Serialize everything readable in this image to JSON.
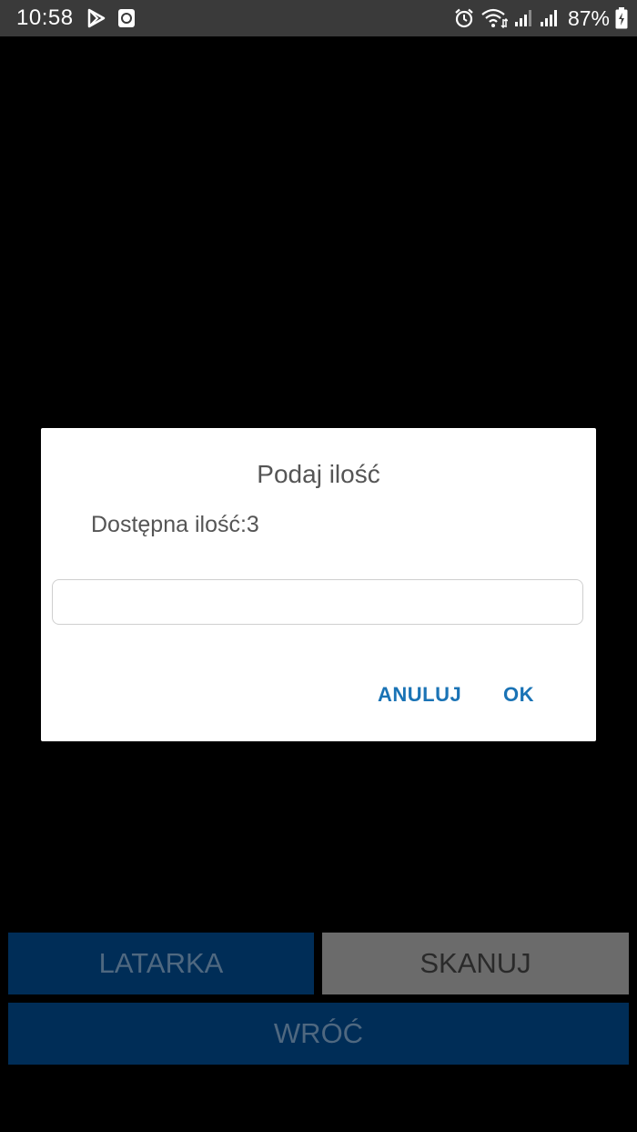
{
  "status_bar": {
    "time": "10:58",
    "battery": "87%",
    "icons": [
      "play-store-icon",
      "screen-record-icon",
      "alarm-icon",
      "wifi-icon",
      "signal-icon",
      "signal-icon-2",
      "battery-charging-icon"
    ]
  },
  "dialog": {
    "title": "Podaj ilość",
    "message": "Dostępna ilość:3",
    "input_value": "",
    "input_placeholder": "",
    "cancel_label": "ANULUJ",
    "ok_label": "OK",
    "accent_color": "#1a73b5"
  },
  "buttons": {
    "latarka": "LATARKA",
    "skanuj": "SKANUJ",
    "wroc": "WRÓĆ"
  },
  "colors": {
    "primary_button": "#002d57",
    "secondary_button": "#6b6b6b",
    "status_bar": "#3a3a3a",
    "background": "#000000"
  }
}
